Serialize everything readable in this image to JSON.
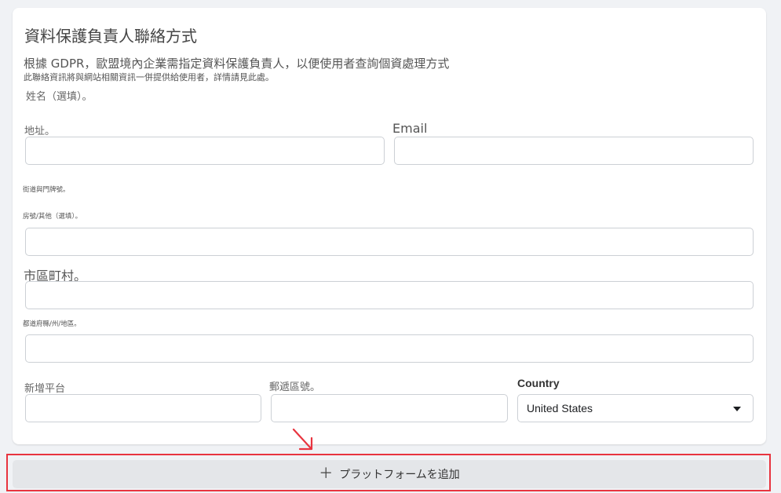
{
  "section": {
    "title": "資料保護負責人聯絡方式",
    "description": "根據 GDPR，歐盟境內企業需指定資料保護負責人，以便使用者查詢個資處理方式",
    "subdescription": "此聯絡資訊將與網站相關資訊一併提供給使用者，詳情請見此處。"
  },
  "form": {
    "name_label": "姓名（選填）。",
    "address_label": "地址。",
    "email_label": "Email",
    "street_hint": "街道與門牌號。",
    "room_label": "房號/其他（選填）。",
    "city_label": "市區町村。",
    "state_label": "都道府縣/州/地區。",
    "platform_label": "新增平台",
    "zip_label": "郵遞區號。",
    "country_label": "Country",
    "country_value": "United States"
  },
  "add_platform": {
    "plus": "＋",
    "label": "プラットフォームを追加"
  },
  "colors": {
    "highlight": "#e8343f",
    "arrow": "#e8343f",
    "button_bg": "#e4e6e9"
  }
}
